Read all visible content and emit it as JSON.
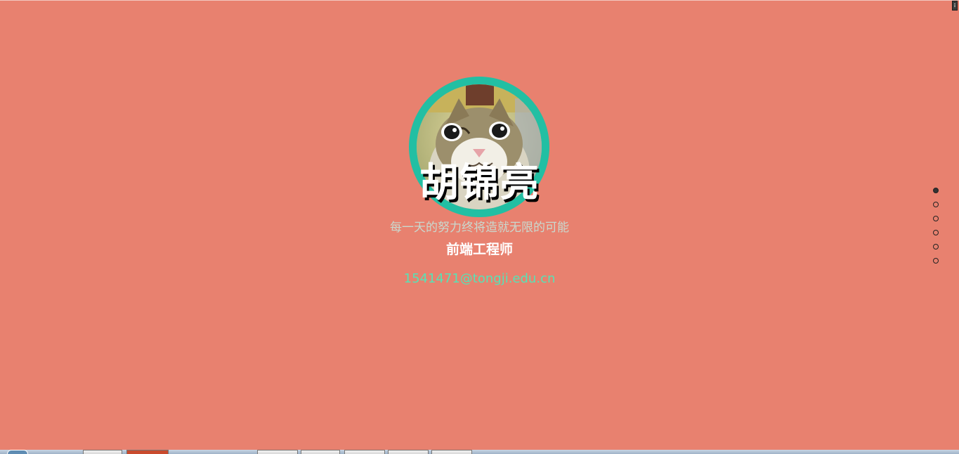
{
  "profile": {
    "name": "胡锦亮",
    "motto": "每一天的努力终将造就无限的可能",
    "role": "前端工程师",
    "email": "1541471@tongji.edu.cn"
  },
  "nav_dots": {
    "count": 6,
    "active_index": 0
  },
  "colors": {
    "background": "#e8816f",
    "avatar_ring": "#22bfa3",
    "email": "#56e3b6",
    "motto": "#c9d9cf"
  },
  "avatar": {
    "icon": "cat-avatar-icon"
  }
}
